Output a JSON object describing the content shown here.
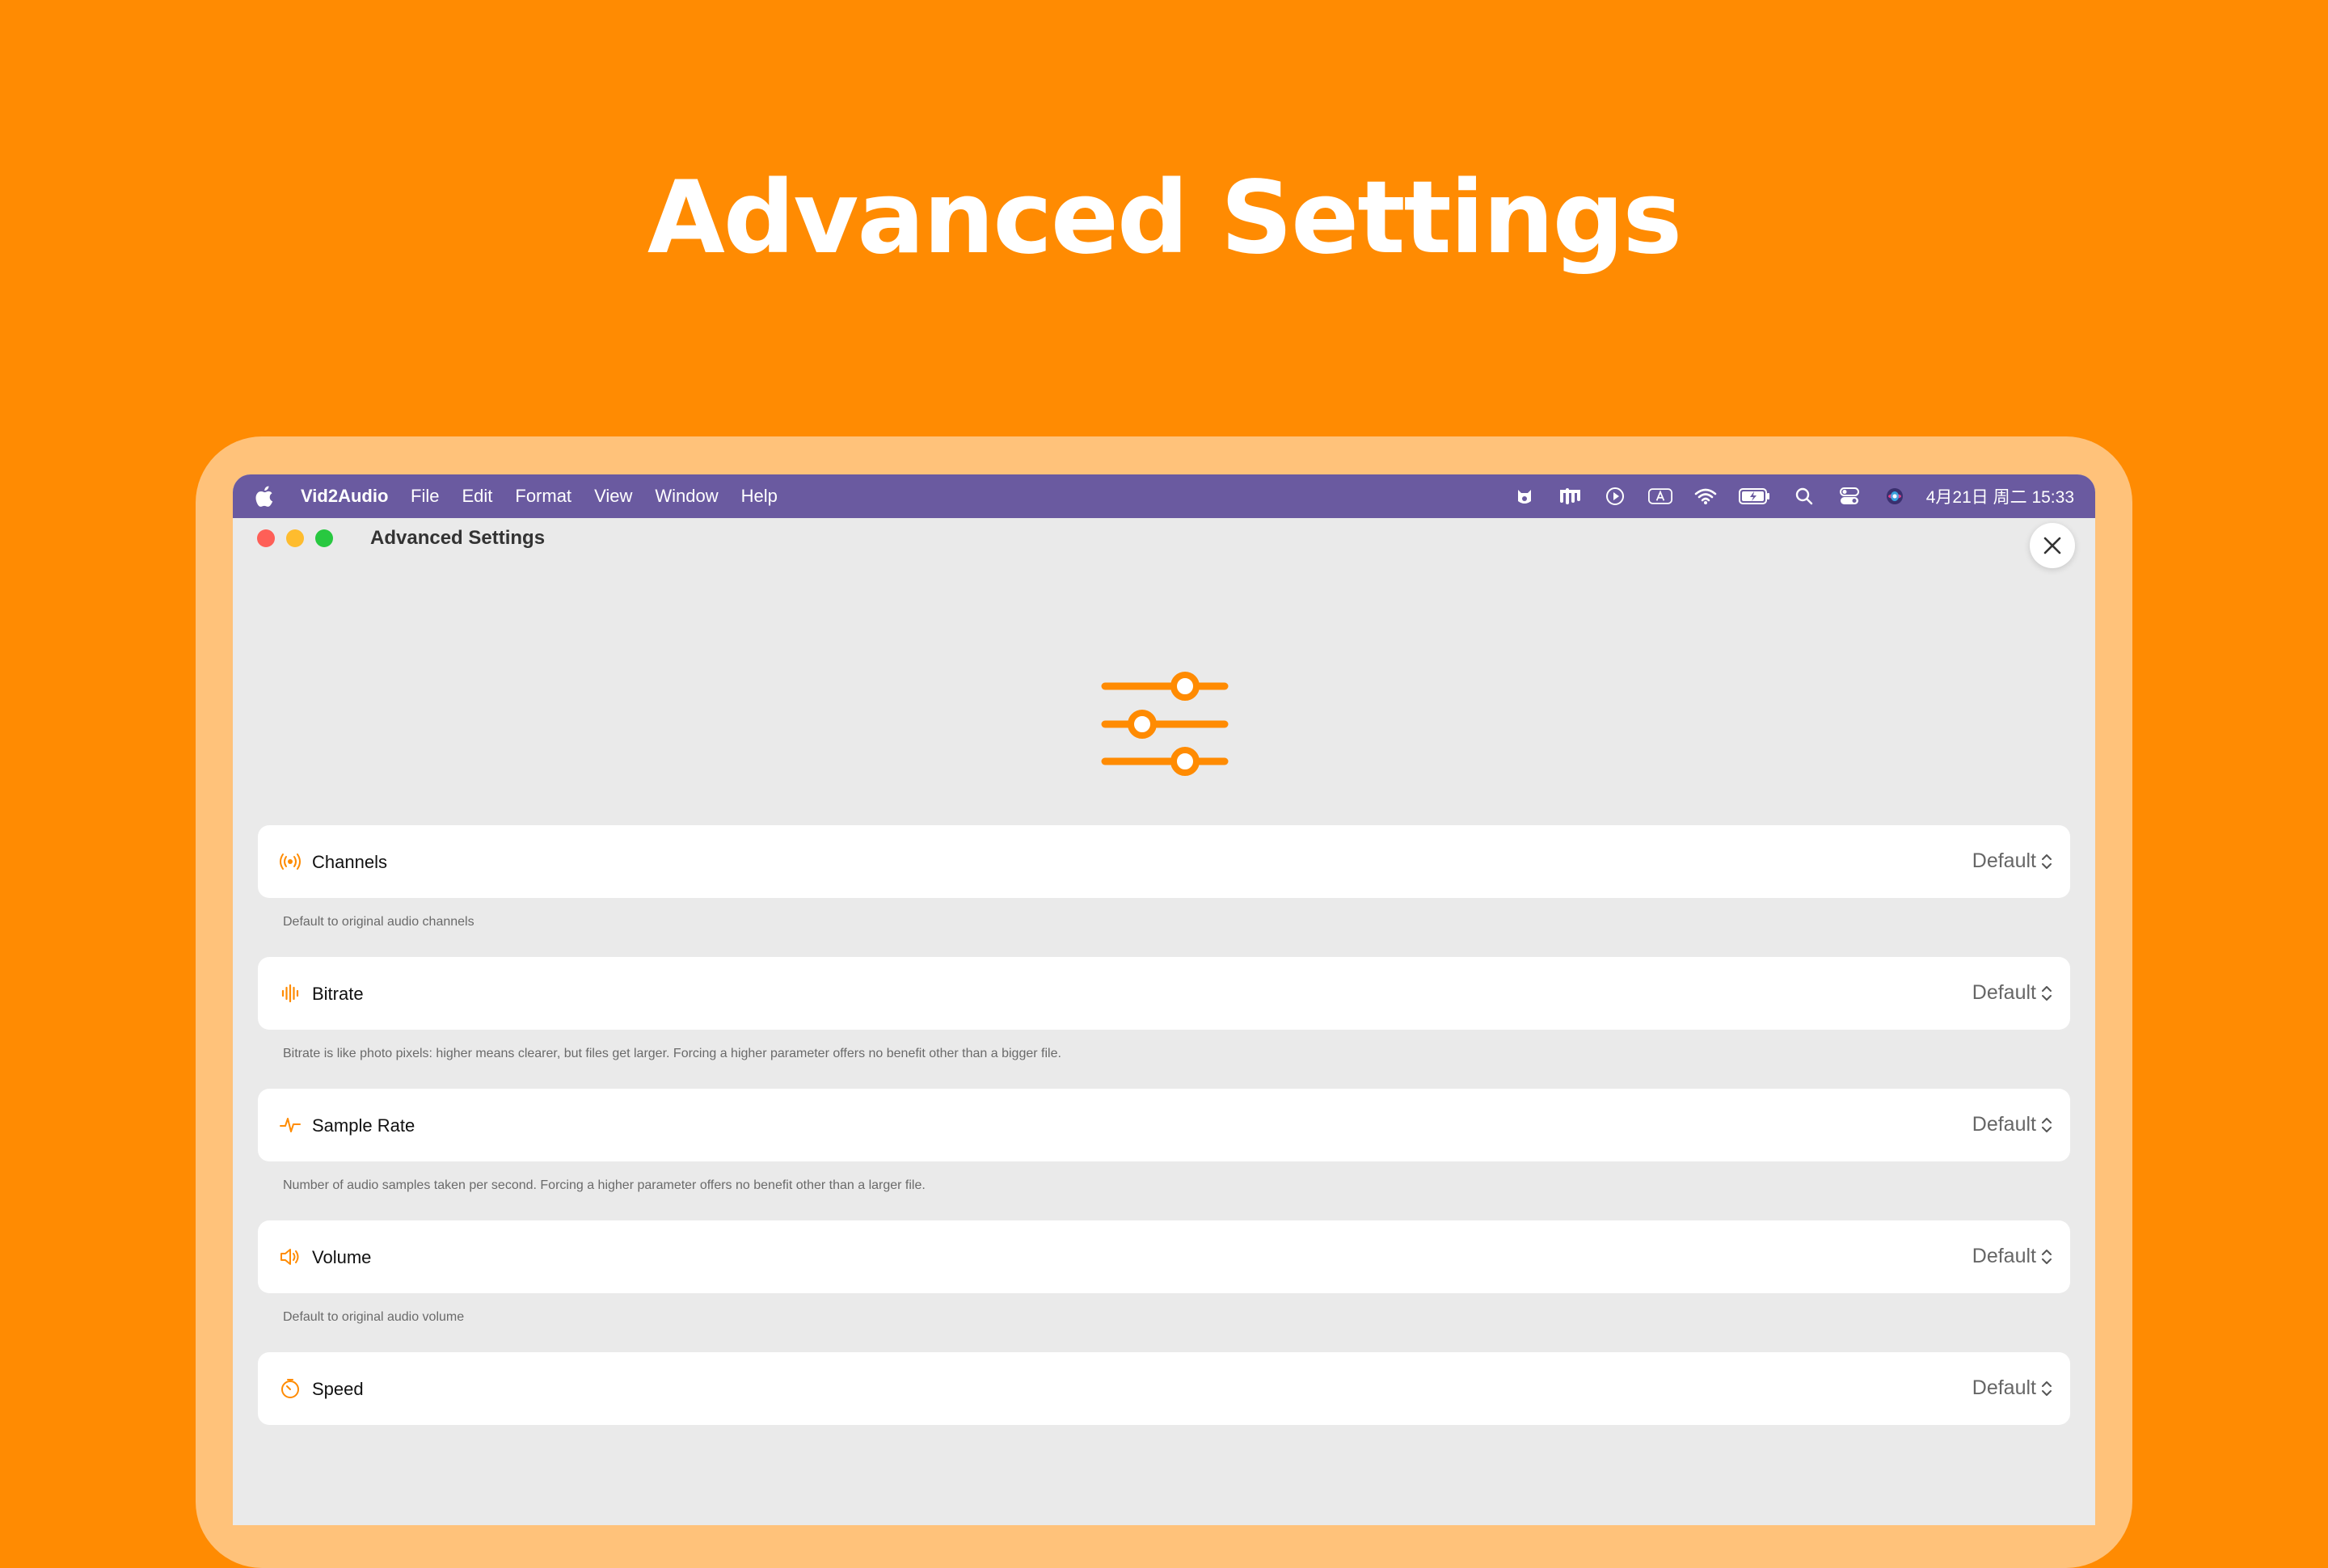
{
  "hero": {
    "title": "Advanced Settings"
  },
  "menubar": {
    "app_name": "Vid2Audio",
    "menus": [
      "File",
      "Edit",
      "Format",
      "View",
      "Window",
      "Help"
    ],
    "status_icons": [
      "cat-badge-icon",
      "bars-icon",
      "play-circle-icon",
      "input-source-icon",
      "wifi-icon",
      "battery-icon",
      "spotlight-search-icon",
      "control-center-icon",
      "siri-icon"
    ],
    "clock": "4月21日 周二  15:33"
  },
  "window": {
    "title": "Advanced Settings",
    "close_icon": "close-icon",
    "hero_icon": "sliders-icon"
  },
  "settings": [
    {
      "label": "Channels",
      "icon": "broadcast-icon",
      "value": "Default",
      "description": "Default to original audio channels"
    },
    {
      "label": "Bitrate",
      "icon": "waveform-icon",
      "value": "Default",
      "description": "Bitrate is like photo pixels: higher means clearer, but files get larger. Forcing a higher parameter offers no benefit other than a bigger file."
    },
    {
      "label": "Sample Rate",
      "icon": "pulse-icon",
      "value": "Default",
      "description": "Number of audio samples taken per second. Forcing a higher parameter offers no benefit other than a larger file."
    },
    {
      "label": "Volume",
      "icon": "speaker-icon",
      "value": "Default",
      "description": "Default to original audio volume"
    },
    {
      "label": "Speed",
      "icon": "timer-icon",
      "value": "Default",
      "description": ""
    }
  ],
  "colors": {
    "background": "#FF8B02",
    "frame": "#FFC27A",
    "menubar": "#6A5AA0",
    "accent": "#FF8B02"
  }
}
